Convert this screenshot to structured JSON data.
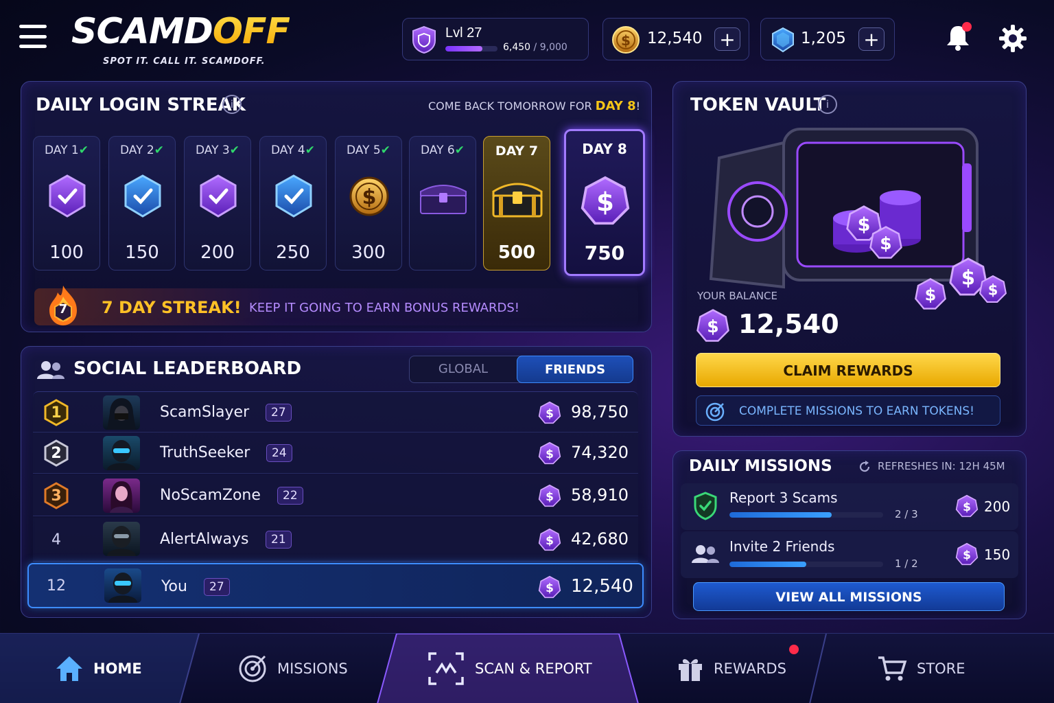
{
  "header": {
    "logo_main": "SCAMD",
    "logo_accent": "OFF",
    "tagline": "SPOT IT. CALL IT. SCAMDOFF.",
    "level_label": "Lvl 27",
    "xp_current": "6,450",
    "xp_sep": " / ",
    "xp_max": "9,000",
    "xp_progress": 0.717,
    "coins": "12,540",
    "gems": "1,205",
    "plus": "+"
  },
  "streak": {
    "title": "DAILY LOGIN STREAK",
    "come_back": "COME BACK TOMORROW FOR ",
    "come_back_day": "DAY 8",
    "come_back_end": "!",
    "check": "✔",
    "days": [
      {
        "label": "DAY 1",
        "amount": "100",
        "icon": "purple-shield-check-icon",
        "claimed": true
      },
      {
        "label": "DAY 2",
        "amount": "150",
        "icon": "blue-shield-check-icon",
        "claimed": true
      },
      {
        "label": "DAY 3",
        "amount": "200",
        "icon": "purple-shield-check-icon",
        "claimed": true
      },
      {
        "label": "DAY 4",
        "amount": "250",
        "icon": "blue-shield-check-icon",
        "claimed": true
      },
      {
        "label": "DAY 5",
        "amount": "300",
        "icon": "gold-coin-icon",
        "claimed": true
      },
      {
        "label": "DAY 6",
        "amount": "",
        "icon": "purple-chest-icon",
        "claimed": true
      },
      {
        "label": "DAY 7",
        "amount": "500",
        "icon": "gold-chest-icon",
        "claimed": false
      },
      {
        "label": "DAY 8",
        "amount": "750",
        "icon": "purple-token-icon",
        "claimed": false
      }
    ],
    "badge_number": "7",
    "streak_text": "7 DAY STREAK!",
    "streak_sub": "KEEP IT GOING TO EARN BONUS REWARDS!"
  },
  "leaderboard": {
    "title": "SOCIAL LEADERBOARD",
    "tabs": [
      "GLOBAL",
      "FRIENDS"
    ],
    "rows": [
      {
        "rank": "1",
        "name": "ScamSlayer",
        "level": "27",
        "score": "98,750"
      },
      {
        "rank": "2",
        "name": "TruthSeeker",
        "level": "24",
        "score": "74,320"
      },
      {
        "rank": "3",
        "name": "NoScamZone",
        "level": "22",
        "score": "58,910"
      },
      {
        "rank": "4",
        "name": "AlertAlways",
        "level": "21",
        "score": "42,680"
      },
      {
        "rank": "12",
        "name": "You",
        "level": "27",
        "score": "12,540"
      }
    ]
  },
  "vault": {
    "title": "TOKEN VAULT",
    "balance_label": "YOUR BALANCE",
    "balance": "12,540",
    "claim": "CLAIM REWARDS",
    "missions_hint": "COMPLETE MISSIONS TO EARN TOKENS!"
  },
  "missions": {
    "title": "DAILY MISSIONS",
    "refresh": "REFRESHES IN: 12H 45M",
    "items": [
      {
        "name": "Report 3 Scams",
        "progress": "2 / 3",
        "fraction": 0.667,
        "reward": "200"
      },
      {
        "name": "Invite 2 Friends",
        "progress": "1 / 2",
        "fraction": 0.5,
        "reward": "150"
      }
    ],
    "view_all": "VIEW ALL MISSIONS"
  },
  "nav": {
    "home": "HOME",
    "missions": "MISSIONS",
    "scan": "SCAN & REPORT",
    "rewards": "REWARDS",
    "store": "STORE"
  },
  "colors": {
    "accent_gold": "#f5c518",
    "accent_purple": "#8b3dff",
    "accent_blue": "#2d7cf0",
    "check_green": "#2fd86c"
  }
}
